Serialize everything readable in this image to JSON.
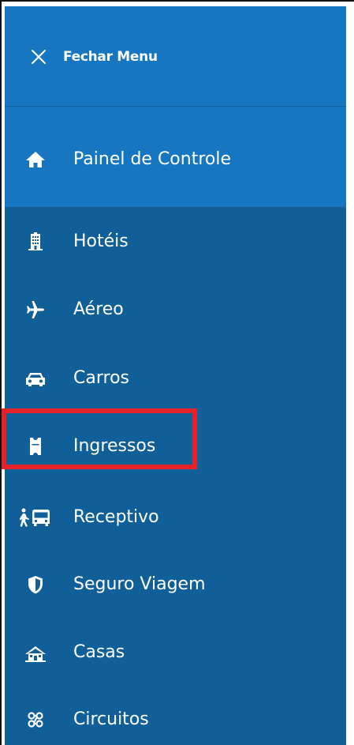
{
  "menu": {
    "close_label": "Fechar Menu",
    "dashboard_label": "Painel de Controle",
    "items": [
      {
        "label": "Hotéis",
        "icon": "hotel-building-icon"
      },
      {
        "label": "Aéreo",
        "icon": "airplane-icon"
      },
      {
        "label": "Carros",
        "icon": "car-icon"
      },
      {
        "label": "Ingressos",
        "icon": "ticket-icon"
      },
      {
        "label": "Receptivo",
        "icon": "walker-bus-icon"
      },
      {
        "label": "Seguro Viagem",
        "icon": "shield-icon"
      },
      {
        "label": "Casas",
        "icon": "house-icon"
      },
      {
        "label": "Circuitos",
        "icon": "route-circuit-icon"
      }
    ]
  },
  "colors": {
    "sidebar_bg": "#115f99",
    "header_bg": "#1676c1",
    "text": "#ffffff",
    "highlight": "#e5222a"
  }
}
